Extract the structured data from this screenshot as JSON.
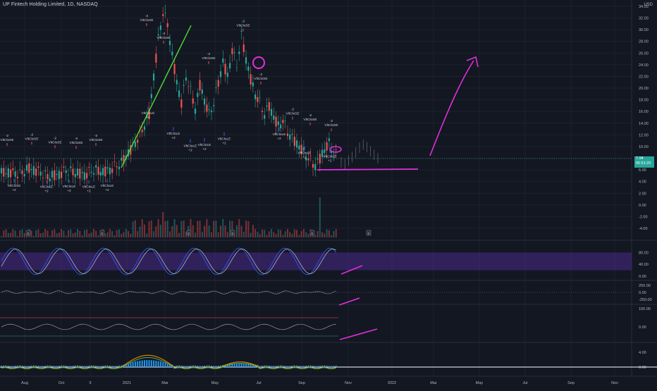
{
  "header": {
    "title": "UP Fintech Holding Limited, 1D, NASDAQ",
    "currency": "USD"
  },
  "last_price": {
    "value": "7.94",
    "countdown": "05:51:20"
  },
  "colors": {
    "background": "#131722",
    "grid": "#1e222d",
    "up": "#26a69a",
    "down": "#ef5350",
    "annotation": "#e02fd9",
    "trendline": "#4ee02f",
    "rsi_band": "#4a2a8a",
    "macd_line": "#ff9800",
    "signal_line": "#4caf50"
  },
  "chart_data": [
    {
      "type": "candlestick",
      "name": "price",
      "x_ticks": [
        "Aug",
        "Oct",
        "9",
        "2021",
        "Mar",
        "May",
        "Jul",
        "Sep",
        "Nov",
        "2022",
        "Mar",
        "May",
        "Jul",
        "Sep",
        "Nov"
      ],
      "y_ticks": [
        "34.00",
        "32.00",
        "30.00",
        "28.00",
        "26.00",
        "24.00",
        "22.00",
        "20.00",
        "18.00",
        "16.00",
        "14.00",
        "12.00",
        "10.00",
        "8.00",
        "6.00",
        "4.00",
        "2.00",
        "0.00",
        "-2.00",
        "-4.00"
      ],
      "ylim": [
        -4,
        34
      ],
      "close_path": [
        [
          0,
          5.4
        ],
        [
          4,
          5.6
        ],
        [
          8,
          5.3
        ],
        [
          12,
          6.2
        ],
        [
          16,
          5.8
        ],
        [
          20,
          4.8
        ],
        [
          24,
          5.1
        ],
        [
          28,
          5.9
        ],
        [
          32,
          5.5
        ],
        [
          36,
          5.2
        ],
        [
          40,
          6.0
        ],
        [
          44,
          5.6
        ],
        [
          48,
          6.3
        ],
        [
          52,
          7.2
        ],
        [
          56,
          9.5
        ],
        [
          60,
          12.0
        ],
        [
          64,
          15.5
        ],
        [
          66,
          22.0
        ],
        [
          68,
          28.5
        ],
        [
          70,
          33.0
        ],
        [
          72,
          31.0
        ],
        [
          74,
          25.5
        ],
        [
          76,
          21.0
        ],
        [
          78,
          17.5
        ],
        [
          80,
          22.0
        ],
        [
          82,
          19.5
        ],
        [
          84,
          16.5
        ],
        [
          86,
          20.5
        ],
        [
          88,
          18.0
        ],
        [
          90,
          15.5
        ],
        [
          92,
          17.5
        ],
        [
          94,
          21.0
        ],
        [
          96,
          24.5
        ],
        [
          98,
          22.0
        ],
        [
          100,
          26.5
        ],
        [
          102,
          24.0
        ],
        [
          104,
          29.0
        ],
        [
          106,
          25.0
        ],
        [
          108,
          21.5
        ],
        [
          110,
          19.0
        ],
        [
          112,
          17.5
        ],
        [
          114,
          15.5
        ],
        [
          116,
          17.0
        ],
        [
          118,
          15.0
        ],
        [
          120,
          13.5
        ],
        [
          122,
          14.5
        ],
        [
          124,
          12.5
        ],
        [
          126,
          11.5
        ],
        [
          128,
          10.5
        ],
        [
          130,
          9.5
        ],
        [
          132,
          8.5
        ],
        [
          134,
          7.5
        ],
        [
          136,
          6.8
        ],
        [
          138,
          8.0
        ],
        [
          140,
          9.5
        ],
        [
          142,
          10.5
        ],
        [
          144,
          9.0
        ],
        [
          146,
          8.2
        ]
      ],
      "series": [
        {
          "name": "VltCloSE",
          "labels": [
            "VltCloSE",
            "VltCloSE",
            "VltCloSE",
            "VltCloSE",
            "VltCloSE",
            "VltCloSE",
            "VltCloSE",
            "VltCloSE"
          ]
        },
        {
          "name": "VltCloLE",
          "labels": [
            "VltCloLE",
            "VltCloLE",
            "VltCloLE",
            "VltCloLE",
            "VltCloLE",
            "VltCloLE",
            "VltCloLE"
          ]
        }
      ],
      "signal_text_short": "-2",
      "signal_text_long": "+2",
      "annotations": {
        "trendline": "green rising line from Dec 2020 to Feb 2021",
        "circle": "magenta circle near Jun 2021 top",
        "ellipse": "magenta ellipse near Sep 2021 low",
        "support": "magenta horizontal support line at 6.50",
        "projection": "magenta upward arrow toward May 2022"
      }
    },
    {
      "type": "area",
      "name": "volume",
      "y_ticks": []
    },
    {
      "type": "line",
      "name": "stoch-rsi",
      "y_ticks": [
        "80.00",
        "40.00",
        "0.00"
      ],
      "band": [
        20,
        80
      ]
    },
    {
      "type": "line",
      "name": "oscillator-2",
      "y_ticks": [
        "250.00",
        "0.00",
        "-250.00"
      ]
    },
    {
      "type": "line",
      "name": "oscillator-3",
      "y_ticks": [
        "100.00",
        "0.00"
      ]
    },
    {
      "type": "area",
      "name": "macd",
      "y_ticks": [
        "4.00",
        "0.00"
      ]
    }
  ]
}
